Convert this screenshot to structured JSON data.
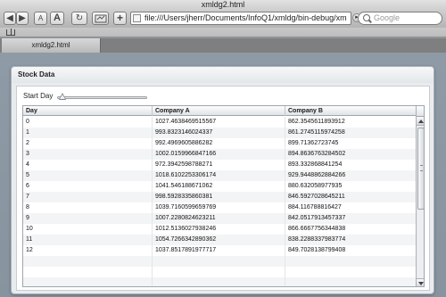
{
  "browser": {
    "window_title": "xmldg2.html",
    "url": "file:///Users/jherr/Documents/InfoQ1/xmldg/bin-debug/xm",
    "search_placeholder": "Google",
    "tab_title": "xmldg2.html",
    "buttons": {
      "back": "◀",
      "forward": "▶",
      "text_smaller": "A",
      "text_larger": "A",
      "reload": "↻",
      "add_bookmark": "+"
    }
  },
  "panel": {
    "title": "Stock Data",
    "slider_label": "Start Day",
    "slider_value": 0
  },
  "grid": {
    "columns": [
      "Day",
      "Company A",
      "Company B"
    ],
    "rows": [
      [
        "0",
        "1027.4638469515567",
        "862.3545611893912"
      ],
      [
        "1",
        "993.8323146024337",
        "861.2745115974258"
      ],
      [
        "2",
        "992.4969605886282",
        "899.71362723745"
      ],
      [
        "3",
        "1002.0159966847166",
        "894.8636763284502"
      ],
      [
        "4",
        "972.3942598788271",
        "893.332868841254"
      ],
      [
        "5",
        "1018.6102253306174",
        "929.9448862884266"
      ],
      [
        "6",
        "1041.546188671062",
        "880.632058977935"
      ],
      [
        "7",
        "998.5928335860381",
        "846.5927028645211"
      ],
      [
        "8",
        "1039.7160599659769",
        "884.116788816427"
      ],
      [
        "9",
        "1007.2280824623211",
        "842.0517913457337"
      ],
      [
        "10",
        "1012.5136027938246",
        "866.6667756344838"
      ],
      [
        "11",
        "1054.7266342890362",
        "838.2288337983774"
      ],
      [
        "12",
        "1037.8517891977717",
        "849.7028138799408"
      ]
    ]
  }
}
